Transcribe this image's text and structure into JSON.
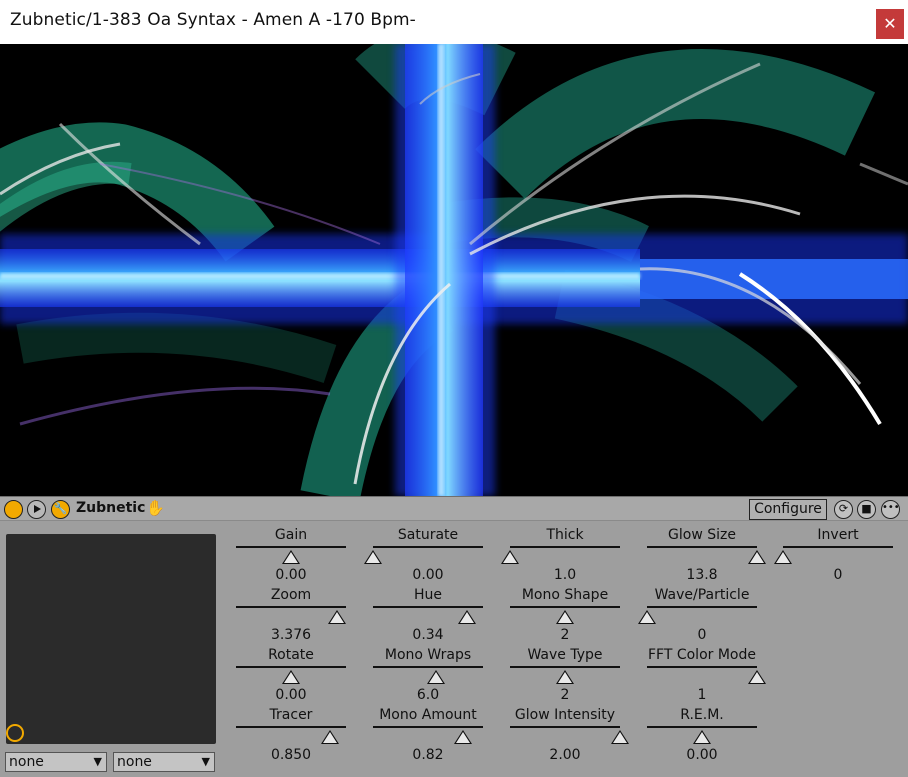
{
  "window": {
    "title": "Zubnetic/1-383 Oa Syntax - Amen A -170 Bpm-",
    "close_glyph": "✕"
  },
  "device": {
    "name": "Zubnetic",
    "configure_label": "Configure",
    "icons": [
      "power-icon",
      "play-icon",
      "wrench-icon",
      "hand-icon",
      "cycle-icon",
      "save-icon",
      "more-icon"
    ],
    "accent_color": "#f2a900",
    "selects": [
      {
        "value": "none"
      },
      {
        "value": "none"
      }
    ]
  },
  "params": [
    {
      "label": "Gain",
      "value": "0.00",
      "level": 0.5
    },
    {
      "label": "Saturate",
      "value": "0.00",
      "level": 0.0
    },
    {
      "label": "Thick",
      "value": "1.0",
      "level": 0.0
    },
    {
      "label": "Glow Size",
      "value": "13.8",
      "level": 1.0
    },
    {
      "label": "Invert",
      "value": "0",
      "level": 0.0
    },
    {
      "label": "Zoom",
      "value": "3.376",
      "level": 0.92
    },
    {
      "label": "Hue",
      "value": "0.34",
      "level": 0.85
    },
    {
      "label": "Mono Shape",
      "value": "2",
      "level": 0.5
    },
    {
      "label": "Wave/Particle",
      "value": "0",
      "level": 0.0
    },
    {
      "label": "Rotate",
      "value": "0.00",
      "level": 0.5
    },
    {
      "label": "Mono Wraps",
      "value": "6.0",
      "level": 0.57
    },
    {
      "label": "Wave Type",
      "value": "2",
      "level": 0.5
    },
    {
      "label": "FFT Color Mode",
      "value": "1",
      "level": 1.0
    },
    {
      "label": "Tracer",
      "value": "0.850",
      "level": 0.85
    },
    {
      "label": "Mono Amount",
      "value": "0.82",
      "level": 0.82
    },
    {
      "label": "Glow Intensity",
      "value": "2.00",
      "level": 1.0
    },
    {
      "label": "R.E.M.",
      "value": "0.00",
      "level": 0.5
    }
  ]
}
